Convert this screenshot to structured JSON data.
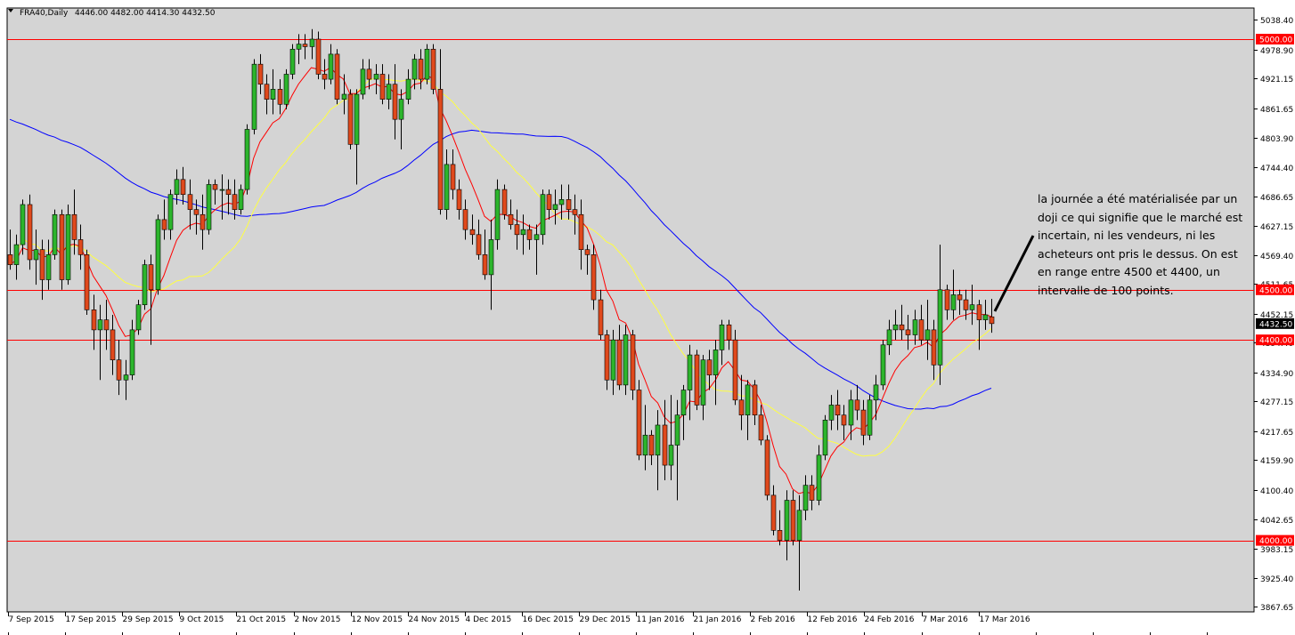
{
  "header": {
    "symbol": "FRA40,Daily",
    "ohlc": "4446.00 4482.00 4414.30 4432.50"
  },
  "colors": {
    "background": "#d4d4d4",
    "bull": "#2cb52c",
    "bear": "#e0491c",
    "level_line": "#ff0000",
    "ma_red": "#ff0000",
    "ma_yellow": "#ffff40",
    "ma_blue": "#0000ff",
    "price_label_bg": "#000000",
    "level_label_bg": "#ff0000"
  },
  "annotation": "la journée a été matérialisée par un doji ce qui signifie que le marché est incertain, ni les vendeurs, ni les acheteurs ont pris le dessus. On est en range entre 4500 et 4400, un intervalle de 100 points.",
  "chart_data": {
    "type": "candlestick",
    "y_ticks": [
      5038.4,
      4978.9,
      4921.15,
      4861.65,
      4803.9,
      4744.4,
      4686.65,
      4627.15,
      4569.4,
      4511.65,
      4452.15,
      4394.4,
      4334.9,
      4277.15,
      4217.65,
      4159.9,
      4100.4,
      4042.65,
      3983.15,
      3925.4,
      3867.65
    ],
    "y_range": [
      3855,
      5060
    ],
    "x_labels": [
      "7 Sep 2015",
      "17 Sep 2015",
      "29 Sep 2015",
      "9 Oct 2015",
      "21 Oct 2015",
      "2 Nov 2015",
      "12 Nov 2015",
      "24 Nov 2015",
      "4 Dec 2015",
      "16 Dec 2015",
      "29 Dec 2015",
      "11 Jan 2016",
      "21 Jan 2016",
      "2 Feb 2016",
      "12 Feb 2016",
      "24 Feb 2016",
      "7 Mar 2016",
      "17 Mar 2016"
    ],
    "horizontal_levels": [
      {
        "value": 5000.0,
        "label": "5000.00"
      },
      {
        "value": 4500.0,
        "label": "4500.00"
      },
      {
        "value": 4400.0,
        "label": "4400.00"
      },
      {
        "value": 4000.0,
        "label": "4000.00"
      }
    ],
    "current_price": {
      "value": 4432.5,
      "label": "4432.50"
    },
    "candles": [
      [
        4570,
        4620,
        4540,
        4550
      ],
      [
        4550,
        4610,
        4520,
        4590
      ],
      [
        4590,
        4680,
        4570,
        4670
      ],
      [
        4670,
        4690,
        4540,
        4560
      ],
      [
        4560,
        4620,
        4510,
        4580
      ],
      [
        4580,
        4600,
        4480,
        4520
      ],
      [
        4520,
        4600,
        4500,
        4570
      ],
      [
        4570,
        4660,
        4560,
        4650
      ],
      [
        4650,
        4660,
        4500,
        4520
      ],
      [
        4520,
        4670,
        4510,
        4650
      ],
      [
        4650,
        4700,
        4570,
        4600
      ],
      [
        4600,
        4630,
        4540,
        4570
      ],
      [
        4570,
        4580,
        4450,
        4460
      ],
      [
        4460,
        4490,
        4380,
        4420
      ],
      [
        4420,
        4470,
        4320,
        4440
      ],
      [
        4440,
        4480,
        4380,
        4420
      ],
      [
        4420,
        4450,
        4330,
        4360
      ],
      [
        4360,
        4400,
        4290,
        4320
      ],
      [
        4320,
        4360,
        4280,
        4330
      ],
      [
        4330,
        4440,
        4320,
        4420
      ],
      [
        4420,
        4480,
        4410,
        4470
      ],
      [
        4470,
        4560,
        4460,
        4550
      ],
      [
        4550,
        4570,
        4390,
        4500
      ],
      [
        4500,
        4650,
        4490,
        4640
      ],
      [
        4640,
        4680,
        4600,
        4620
      ],
      [
        4620,
        4700,
        4600,
        4690
      ],
      [
        4690,
        4740,
        4670,
        4720
      ],
      [
        4720,
        4745,
        4670,
        4690
      ],
      [
        4690,
        4720,
        4620,
        4660
      ],
      [
        4660,
        4680,
        4610,
        4650
      ],
      [
        4650,
        4690,
        4580,
        4620
      ],
      [
        4620,
        4720,
        4610,
        4710
      ],
      [
        4710,
        4720,
        4670,
        4700
      ],
      [
        4700,
        4730,
        4640,
        4700
      ],
      [
        4700,
        4720,
        4650,
        4690
      ],
      [
        4690,
        4720,
        4640,
        4660
      ],
      [
        4660,
        4710,
        4650,
        4700
      ],
      [
        4700,
        4830,
        4690,
        4820
      ],
      [
        4820,
        4960,
        4810,
        4950
      ],
      [
        4950,
        4970,
        4890,
        4910
      ],
      [
        4910,
        4930,
        4850,
        4880
      ],
      [
        4880,
        4940,
        4850,
        4900
      ],
      [
        4900,
        4920,
        4850,
        4870
      ],
      [
        4870,
        4940,
        4860,
        4930
      ],
      [
        4930,
        4990,
        4920,
        4980
      ],
      [
        4980,
        5010,
        4950,
        4990
      ],
      [
        4990,
        5010,
        4960,
        4985
      ],
      [
        4985,
        5020,
        4960,
        5000
      ],
      [
        5000,
        5015,
        4920,
        4930
      ],
      [
        4930,
        4960,
        4900,
        4920
      ],
      [
        4920,
        4990,
        4910,
        4970
      ],
      [
        4970,
        4980,
        4870,
        4880
      ],
      [
        4880,
        4930,
        4850,
        4890
      ],
      [
        4890,
        4900,
        4780,
        4790
      ],
      [
        4790,
        4900,
        4710,
        4890
      ],
      [
        4890,
        4960,
        4880,
        4940
      ],
      [
        4940,
        4960,
        4900,
        4920
      ],
      [
        4920,
        4950,
        4890,
        4930
      ],
      [
        4930,
        4950,
        4870,
        4880
      ],
      [
        4880,
        4930,
        4860,
        4910
      ],
      [
        4910,
        4950,
        4800,
        4840
      ],
      [
        4840,
        4900,
        4780,
        4880
      ],
      [
        4880,
        4940,
        4870,
        4920
      ],
      [
        4920,
        4970,
        4900,
        4960
      ],
      [
        4960,
        4980,
        4900,
        4920
      ],
      [
        4920,
        4990,
        4910,
        4980
      ],
      [
        4980,
        4990,
        4890,
        4900
      ],
      [
        4900,
        4980,
        4650,
        4660
      ],
      [
        4660,
        4780,
        4640,
        4750
      ],
      [
        4750,
        4780,
        4680,
        4700
      ],
      [
        4700,
        4720,
        4640,
        4660
      ],
      [
        4660,
        4680,
        4600,
        4620
      ],
      [
        4620,
        4650,
        4590,
        4610
      ],
      [
        4610,
        4640,
        4560,
        4570
      ],
      [
        4570,
        4620,
        4520,
        4530
      ],
      [
        4530,
        4640,
        4460,
        4600
      ],
      [
        4600,
        4720,
        4580,
        4700
      ],
      [
        4700,
        4710,
        4640,
        4650
      ],
      [
        4650,
        4680,
        4620,
        4630
      ],
      [
        4630,
        4660,
        4580,
        4610
      ],
      [
        4610,
        4650,
        4570,
        4620
      ],
      [
        4620,
        4630,
        4580,
        4600
      ],
      [
        4600,
        4630,
        4530,
        4610
      ],
      [
        4610,
        4700,
        4590,
        4690
      ],
      [
        4690,
        4700,
        4640,
        4660
      ],
      [
        4660,
        4700,
        4630,
        4670
      ],
      [
        4670,
        4710,
        4640,
        4680
      ],
      [
        4680,
        4710,
        4640,
        4660
      ],
      [
        4660,
        4690,
        4610,
        4650
      ],
      [
        4650,
        4680,
        4540,
        4580
      ],
      [
        4580,
        4590,
        4530,
        4570
      ],
      [
        4570,
        4590,
        4460,
        4480
      ],
      [
        4480,
        4500,
        4400,
        4410
      ],
      [
        4410,
        4420,
        4300,
        4320
      ],
      [
        4320,
        4420,
        4290,
        4400
      ],
      [
        4400,
        4430,
        4300,
        4310
      ],
      [
        4310,
        4430,
        4290,
        4410
      ],
      [
        4410,
        4420,
        4280,
        4300
      ],
      [
        4300,
        4320,
        4160,
        4170
      ],
      [
        4170,
        4270,
        4140,
        4210
      ],
      [
        4210,
        4220,
        4150,
        4170
      ],
      [
        4170,
        4260,
        4100,
        4230
      ],
      [
        4230,
        4280,
        4120,
        4150
      ],
      [
        4150,
        4290,
        4120,
        4190
      ],
      [
        4190,
        4280,
        4080,
        4250
      ],
      [
        4250,
        4310,
        4200,
        4300
      ],
      [
        4300,
        4390,
        4240,
        4370
      ],
      [
        4370,
        4380,
        4260,
        4270
      ],
      [
        4270,
        4370,
        4240,
        4360
      ],
      [
        4360,
        4380,
        4300,
        4330
      ],
      [
        4330,
        4400,
        4270,
        4380
      ],
      [
        4380,
        4440,
        4350,
        4430
      ],
      [
        4430,
        4440,
        4380,
        4400
      ],
      [
        4400,
        4420,
        4270,
        4280
      ],
      [
        4280,
        4330,
        4220,
        4250
      ],
      [
        4250,
        4320,
        4200,
        4310
      ],
      [
        4310,
        4320,
        4230,
        4250
      ],
      [
        4250,
        4270,
        4190,
        4200
      ],
      [
        4200,
        4210,
        4080,
        4090
      ],
      [
        4090,
        4110,
        4010,
        4020
      ],
      [
        4020,
        4060,
        3990,
        4000
      ],
      [
        4000,
        4100,
        3960,
        4080
      ],
      [
        4080,
        4100,
        3990,
        4000
      ],
      [
        4000,
        4090,
        3900,
        4060
      ],
      [
        4060,
        4130,
        4040,
        4110
      ],
      [
        4110,
        4130,
        4060,
        4080
      ],
      [
        4080,
        4190,
        4070,
        4170
      ],
      [
        4170,
        4250,
        4160,
        4240
      ],
      [
        4240,
        4290,
        4220,
        4270
      ],
      [
        4270,
        4300,
        4220,
        4250
      ],
      [
        4250,
        4270,
        4200,
        4230
      ],
      [
        4230,
        4300,
        4200,
        4280
      ],
      [
        4280,
        4310,
        4240,
        4260
      ],
      [
        4260,
        4280,
        4190,
        4210
      ],
      [
        4210,
        4290,
        4200,
        4280
      ],
      [
        4280,
        4330,
        4240,
        4310
      ],
      [
        4310,
        4400,
        4300,
        4390
      ],
      [
        4390,
        4440,
        4370,
        4420
      ],
      [
        4420,
        4460,
        4400,
        4430
      ],
      [
        4430,
        4470,
        4400,
        4420
      ],
      [
        4420,
        4450,
        4380,
        4410
      ],
      [
        4410,
        4460,
        4390,
        4440
      ],
      [
        4440,
        4470,
        4390,
        4400
      ],
      [
        4400,
        4480,
        4360,
        4420
      ],
      [
        4420,
        4440,
        4320,
        4350
      ],
      [
        4350,
        4590,
        4310,
        4500
      ],
      [
        4500,
        4510,
        4440,
        4460
      ],
      [
        4460,
        4540,
        4440,
        4490
      ],
      [
        4490,
        4500,
        4450,
        4480
      ],
      [
        4480,
        4500,
        4440,
        4460
      ],
      [
        4460,
        4510,
        4430,
        4470
      ],
      [
        4470,
        4480,
        4380,
        4440
      ],
      [
        4440,
        4480,
        4420,
        4450
      ],
      [
        4446,
        4482,
        4414.3,
        4432.5
      ]
    ]
  }
}
